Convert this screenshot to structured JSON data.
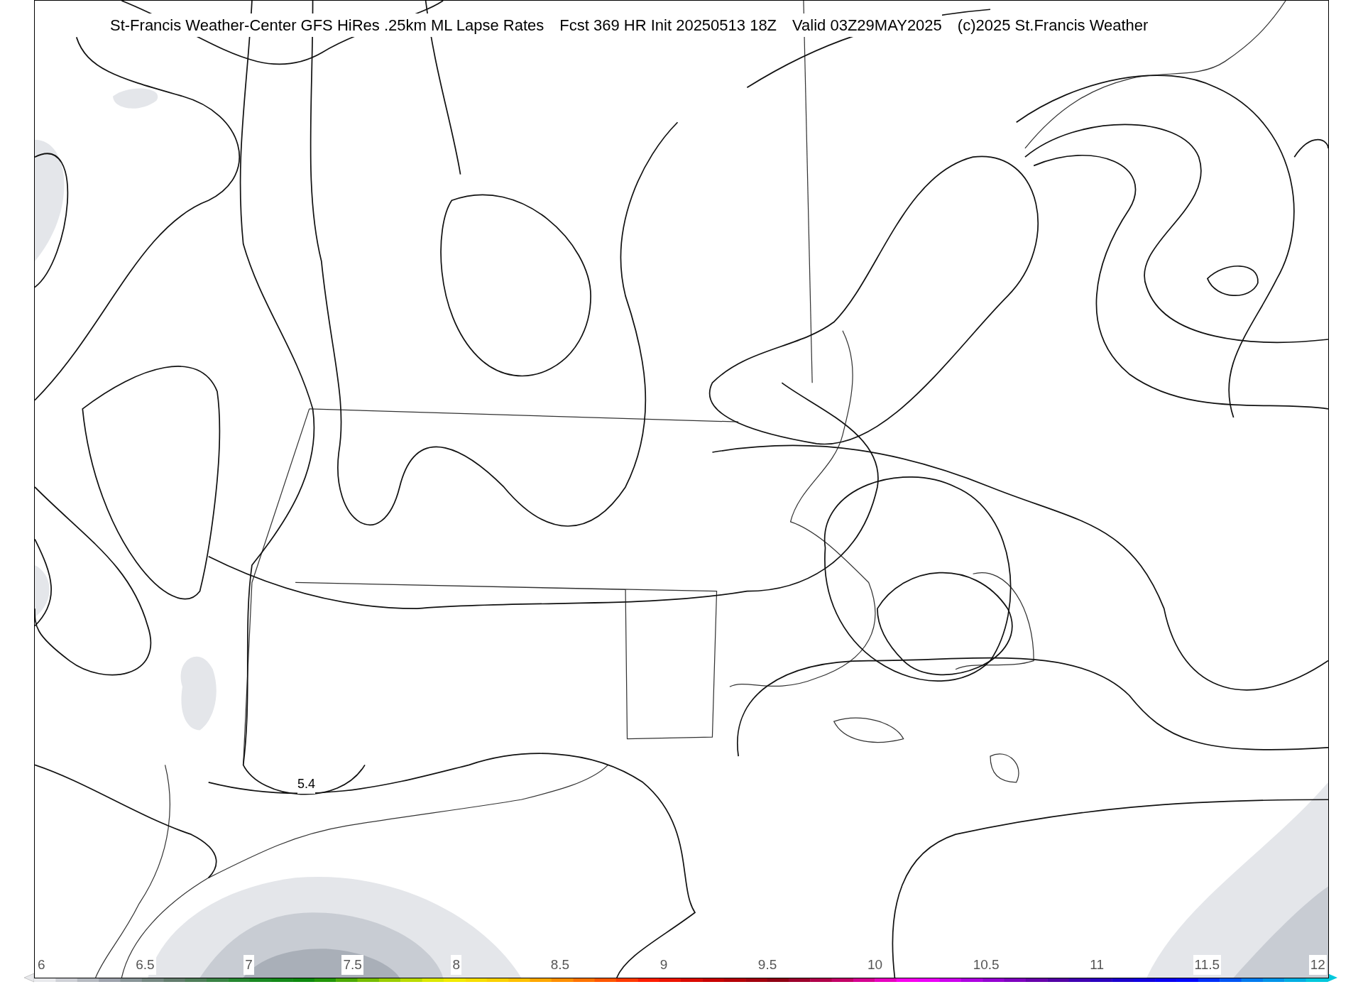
{
  "title_parts": [
    "St-Francis Weather-Center GFS HiRes .25km ML Lapse Rates",
    "Fcst 369 HR Init 20250513 18Z",
    "Valid 03Z29MAY2025",
    "(c)2025 St.Francis Weather"
  ],
  "contour_labels": [
    "5.4"
  ],
  "colorbar": {
    "ticks": [
      "6",
      "6.5",
      "7",
      "7.5",
      "8",
      "8.5",
      "9",
      "9.5",
      "10",
      "10.5",
      "11",
      "11.5",
      "12"
    ]
  }
}
